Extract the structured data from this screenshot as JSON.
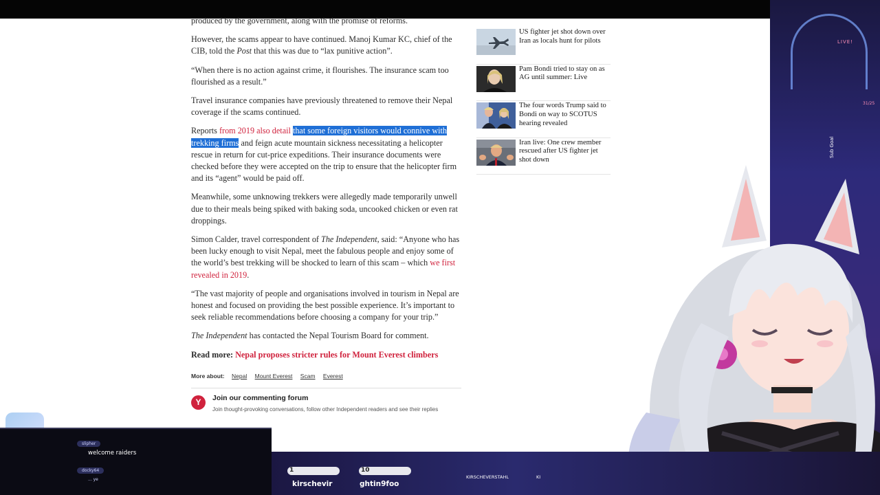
{
  "article": {
    "p0": "produced by the government, along with the promise of reforms.",
    "p1_a": "However, the scams appear to have continued. Manoj Kumar KC, chief of the CIB, told the ",
    "p1_em": "Post",
    "p1_b": " that this was due to “lax punitive action”.",
    "p2": "“When there is no action against crime, it flourishes. The insurance scam too flourished as a result.”",
    "p3": "Travel insurance companies have previously threatened to remove their Nepal coverage if the scams continued.",
    "p4_a": "Reports ",
    "p4_link": "from 2019 also detail",
    "p4_hl": "that some foreign visitors would connive with trekking firms",
    "p4_b": " and feign acute mountain sickness necessitating a helicopter rescue in return for cut-price expeditions. Their insurance documents were checked before they were accepted on the trip to ensure that the helicopter firm and its “agent” would be paid off.",
    "p5": "Meanwhile, some unknowing trekkers were allegedly made temporarily unwell due to their meals being spiked with baking soda, uncooked chicken or even rat droppings.",
    "p6_a": "Simon Calder, travel correspondent of ",
    "p6_em": "The Independent",
    "p6_b": ", said: “Anyone who has been lucky enough to visit Nepal, meet the fabulous people and enjoy some of the world’s best trekking will be shocked to learn of this scam – which ",
    "p6_link": "we first revealed in 2019",
    "p6_c": ".",
    "p7": "“The vast majority of people and organisations involved in tourism in Nepal are honest and focused on providing the best possible experience. It’s important to seek reliable recommendations before choosing a company for your trip.”",
    "p8_em": "The Independent",
    "p8_b": " has contacted the Nepal Tourism Board for comment.",
    "read_more_label": "Read more: ",
    "read_more_link": "Nepal proposes stricter rules for Mount Everest climbers",
    "more_about_label": "More about:",
    "tags": [
      "Nepal",
      "Mount Everest",
      "Scam",
      "Everest"
    ],
    "forum_title": "Join our commenting forum",
    "forum_sub": "Join thought-provoking conversations, follow other Independent readers and see their replies",
    "forum_logo": "Y"
  },
  "sidebar": {
    "stories": [
      {
        "title": "US fighter jet shot down over Iran as locals hunt for pilots",
        "thumb": "jet-thumbnail"
      },
      {
        "title": "Pam Bondi tried to stay on as AG until summer: Live",
        "thumb": "bondi-thumbnail"
      },
      {
        "title": "The four words Trump said to Bondi on way to SCOTUS hearing revealed",
        "thumb": "trump-bondi-thumbnail"
      },
      {
        "title": "Iran live: One crew member rescued after US fighter jet shot down",
        "thumb": "trump-thumbnail"
      }
    ]
  },
  "overlay": {
    "live_badge": "LIVE!",
    "sub_goal": "Sub Goal",
    "goal_count": "31/25",
    "chat": [
      {
        "user": "slipher",
        "message": "welcome raiders"
      },
      {
        "user": "docky64",
        "message": "... ye"
      }
    ],
    "bottom": {
      "pill1_num": "1",
      "pill2_num": "10",
      "name1": "kirschevir",
      "name2": "ghtin9foo",
      "channel": "KIRSCHEVERSTAHL",
      "tail": "KI"
    }
  },
  "colors": {
    "link": "#d0223d",
    "highlight": "#1f6fd6",
    "topbar": "#050505"
  }
}
